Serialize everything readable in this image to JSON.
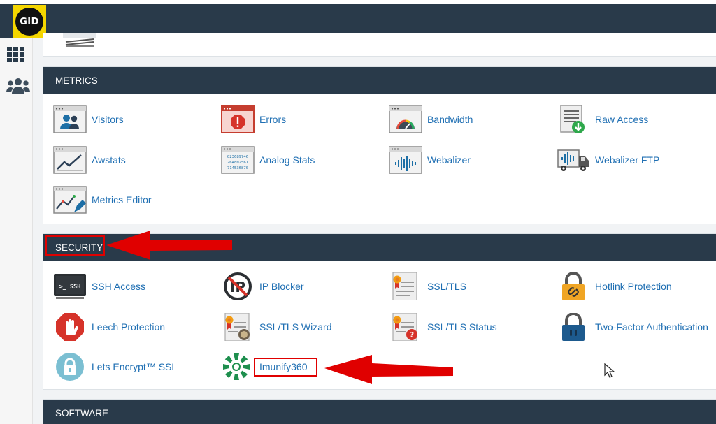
{
  "logo": {
    "text": "GID"
  },
  "sidebar": {
    "items": [
      {
        "icon": "grid-icon"
      },
      {
        "icon": "users-icon"
      }
    ]
  },
  "sections": {
    "metrics": {
      "title": "METRICS",
      "items": [
        {
          "label": "Visitors",
          "icon": "visitors-icon"
        },
        {
          "label": "Errors",
          "icon": "errors-icon"
        },
        {
          "label": "Bandwidth",
          "icon": "bandwidth-icon"
        },
        {
          "label": "Raw Access",
          "icon": "raw-access-icon"
        },
        {
          "label": "Awstats",
          "icon": "awstats-icon"
        },
        {
          "label": "Analog Stats",
          "icon": "analog-stats-icon",
          "digits": [
            "023689746",
            "264802561",
            "714536870"
          ]
        },
        {
          "label": "Webalizer",
          "icon": "webalizer-icon"
        },
        {
          "label": "Webalizer FTP",
          "icon": "webalizer-ftp-icon"
        },
        {
          "label": "Metrics Editor",
          "icon": "metrics-editor-icon"
        }
      ]
    },
    "security": {
      "title": "SECURITY",
      "items": [
        {
          "label": "SSH Access",
          "icon": "ssh-terminal-icon",
          "icon_text": ">_ SSH"
        },
        {
          "label": "IP Blocker",
          "icon": "ip-blocker-icon",
          "icon_text": "IP"
        },
        {
          "label": "SSL/TLS",
          "icon": "certificate-icon"
        },
        {
          "label": "Hotlink Protection",
          "icon": "hotlink-lock-icon"
        },
        {
          "label": "Leech Protection",
          "icon": "stop-hand-icon"
        },
        {
          "label": "SSL/TLS Wizard",
          "icon": "certificate-wizard-icon"
        },
        {
          "label": "SSL/TLS Status",
          "icon": "certificate-status-icon"
        },
        {
          "label": "Two-Factor Authentication",
          "icon": "two-factor-lock-icon"
        },
        {
          "label": "Lets Encrypt™ SSL",
          "icon": "lets-encrypt-icon"
        },
        {
          "label": "Imunify360",
          "icon": "imunify360-icon"
        }
      ]
    },
    "software": {
      "title": "SOFTWARE"
    }
  },
  "annotations": {
    "highlight_color": "#e00000",
    "arrows": [
      "arrow-to-security",
      "arrow-to-imunify360"
    ]
  },
  "colors": {
    "topbar": "#293a4a",
    "logo_bg": "#f5d600",
    "link": "#1f6fb3",
    "panel_bg": "#f1f3f5"
  }
}
